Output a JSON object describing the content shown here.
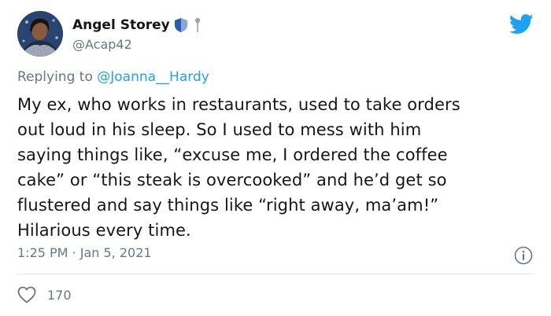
{
  "author": {
    "name": "Angel Storey",
    "handle": "@Acap42"
  },
  "reply": {
    "prefix": "Replying to ",
    "mention": "@Joanna__Hardy"
  },
  "body_lines": [
    "My ex, who works in restaurants, used to take orders",
    "out loud in his sleep. So I used to mess with him",
    "saying things like, “excuse me, I ordered the coffee",
    "cake” or “this steak is overcooked” and he’d get so",
    "flustered and say things like “right away, ma’am!”",
    "Hilarious every time."
  ],
  "meta": {
    "time": "1:25 PM",
    "separator": " · ",
    "date": "Jan 5, 2021"
  },
  "stats": {
    "likes": "170"
  },
  "icons": {
    "verified_badge": "shield-icon",
    "pin": "pin-icon",
    "logo": "twitter-bird-icon",
    "info": "info-icon",
    "like": "heart-icon"
  },
  "colors": {
    "brand": "#1da1f2",
    "muted": "#657786",
    "text": "#14171a",
    "divider": "#e1e8ed"
  }
}
